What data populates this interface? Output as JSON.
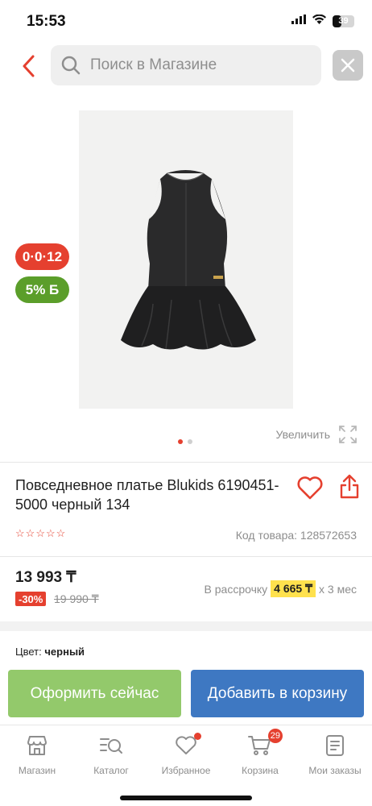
{
  "status_bar": {
    "time": "15:53",
    "battery": "39"
  },
  "search": {
    "placeholder": "Поиск в Магазине"
  },
  "product": {
    "installment_badge": "0·0·12",
    "bonus_badge": "5% Б",
    "zoom_label": "Увеличить",
    "title": "Повседневное платье Blukids 6190451-5000 черный 134",
    "rating_stars": 5,
    "code": "Код товара: 128572653",
    "price": "13 993 ₸",
    "discount": "-30%",
    "old_price": "19 990 ₸",
    "installment": {
      "prefix": "В рассрочку",
      "amount": "4 665 ₸",
      "term": "x 3 мес"
    },
    "color_label": "Цвет:",
    "color_value": "черный",
    "image_count": 2,
    "active_image": 1
  },
  "actions": {
    "order_now": "Оформить сейчас",
    "add_to_cart": "Добавить в корзину"
  },
  "tabbar": {
    "items": [
      {
        "label": "Магазин",
        "icon": "store-icon"
      },
      {
        "label": "Каталог",
        "icon": "catalog-search-icon"
      },
      {
        "label": "Избранное",
        "icon": "heart-icon"
      },
      {
        "label": "Корзина",
        "icon": "cart-icon",
        "badge": "29"
      },
      {
        "label": "Мои заказы",
        "icon": "orders-icon"
      }
    ]
  },
  "colors": {
    "accent_red": "#e5402f",
    "green": "#93c96b",
    "blue": "#3e78c2",
    "yellow": "#ffe14d"
  }
}
